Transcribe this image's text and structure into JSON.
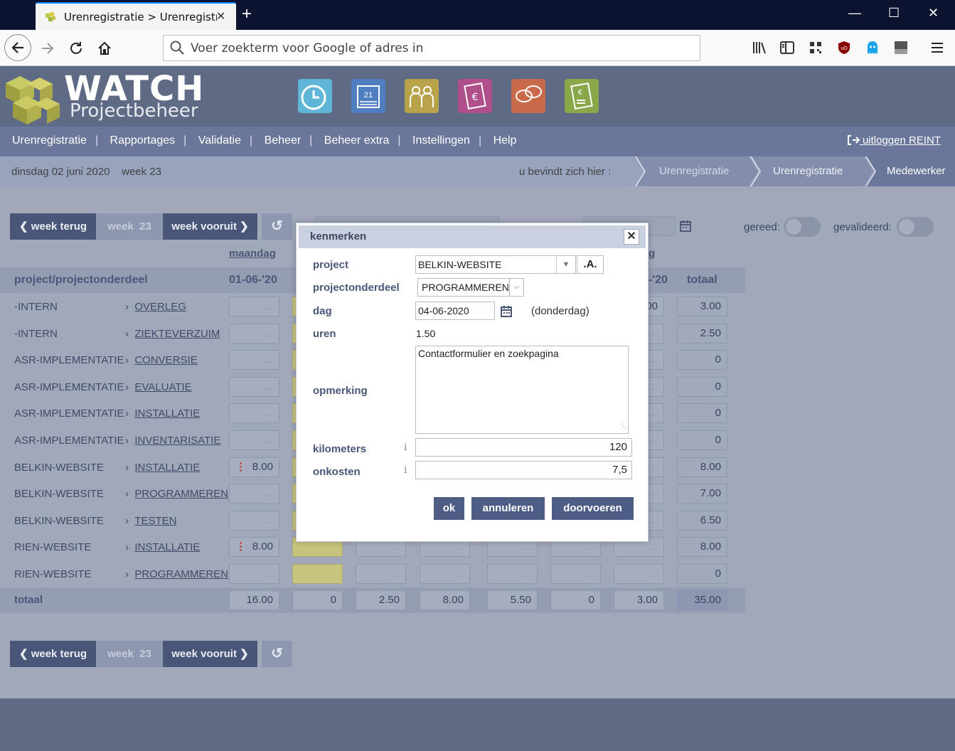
{
  "browser": {
    "tab_title": "Urenregistratie > Urenregistratie",
    "tab_close": "✕",
    "new_tab": "+",
    "window_controls": [
      "—",
      "☐",
      "✕"
    ],
    "url_placeholder": "Voer zoekterm voor Google of adres in",
    "toolbar_icons": [
      "library-icon",
      "sidebar-icon",
      "qr-icon",
      "ublock-icon",
      "ghostery-icon",
      "extension-icon",
      "menu-icon"
    ]
  },
  "app": {
    "logo_title": "WATCH",
    "logo_subtitle": "Projectbeheer",
    "app_icons": [
      {
        "name": "clock-icon",
        "color": "#5fb6d6"
      },
      {
        "name": "calendar-icon",
        "color": "#4f7fc0"
      },
      {
        "name": "people-icon",
        "color": "#b8a34a"
      },
      {
        "name": "invoice-icon",
        "color": "#b0508a"
      },
      {
        "name": "chat-icon",
        "color": "#c86a4a"
      },
      {
        "name": "calculator-icon",
        "color": "#8aa84a"
      }
    ],
    "menu": [
      "Urenregistratie",
      "Rapportages",
      "Validatie",
      "Beheer",
      "Beheer extra",
      "Instellingen",
      "Help"
    ],
    "logout": "uitloggen REINT",
    "date": "dinsdag 02 juni 2020",
    "week": "week 23",
    "here_label": "u bevindt zich hier :",
    "breadcrumbs": [
      "Urenregistratie",
      "Urenregistratie",
      "Medewerker"
    ]
  },
  "week_nav": {
    "back": "week terug",
    "current_label": "week",
    "current_number": "23",
    "forward": "week vooruit",
    "ready_label": "gereed:",
    "validated_label": "gevalideerd:"
  },
  "grid": {
    "day_header": "maandag",
    "day_header_partial": "g",
    "col_project": "project/projectonderdeel",
    "col_date1": "01-06-'20",
    "col_date_last": "-'20",
    "col_total": "totaal",
    "rows": [
      {
        "project": "-INTERN",
        "part": "OVERLEG",
        "mon": "...",
        "partial": "00",
        "total": "3.00"
      },
      {
        "project": "-INTERN",
        "part": "ZIEKTEVERZUIM",
        "mon": "...",
        "partial": "...",
        "total": "2.50"
      },
      {
        "project": "ASR-IMPLEMENTATIE",
        "part": "CONVERSIE",
        "mon": "...",
        "partial": "...",
        "total": "0"
      },
      {
        "project": "ASR-IMPLEMENTATIE",
        "part": "EVALUATIE",
        "mon": "...",
        "partial": "...",
        "total": "0"
      },
      {
        "project": "ASR-IMPLEMENTATIE",
        "part": "INSTALLATIE",
        "mon": "...",
        "partial": "...",
        "total": "0"
      },
      {
        "project": "ASR-IMPLEMENTATIE",
        "part": "INVENTARISATIE",
        "mon": "...",
        "partial": "...",
        "total": "0"
      },
      {
        "project": "BELKIN-WEBSITE",
        "part": "INSTALLATIE",
        "mon": "8.00",
        "partial": "...",
        "total": "8.00"
      },
      {
        "project": "BELKIN-WEBSITE",
        "part": "PROGRAMMEREN",
        "mon": "...",
        "partial": "...",
        "total": "7.00"
      },
      {
        "project": "BELKIN-WEBSITE",
        "part": "TESTEN",
        "mon": "...",
        "partial": "...",
        "total": "6.50"
      },
      {
        "project": "RIEN-WEBSITE",
        "part": "INSTALLATIE",
        "mon": "8.00",
        "partial": "...",
        "total": "8.00"
      },
      {
        "project": "RIEN-WEBSITE",
        "part": "PROGRAMMEREN",
        "mon": "...",
        "partial": "...",
        "total": "0"
      }
    ],
    "row_dots": [
      "...",
      "...",
      "...",
      "...",
      "...",
      "..."
    ],
    "totals_label": "totaal",
    "totals": [
      "16.00",
      "0",
      "2.50",
      "8.00",
      "5.50",
      "0",
      "3.00",
      "35.00"
    ]
  },
  "dialog": {
    "title": "kenmerken",
    "close": "✕",
    "project_label": "project",
    "project_value": "BELKIN-WEBSITE",
    "project_btn": ".A.",
    "part_label": "projectonderdeel",
    "part_value": "PROGRAMMEREN",
    "day_label": "dag",
    "day_value": "04-06-2020",
    "day_name": "(donderdag)",
    "hours_label": "uren",
    "hours_value": "1.50",
    "remark_label": "opmerking",
    "remark_value": "Contactformulier en zoekpagina",
    "km_label": "kilometers",
    "km_value": "120",
    "cost_label": "onkosten",
    "cost_value": "7,5",
    "info_glyph": "i",
    "ok": "ok",
    "cancel": "annuleren",
    "apply": "doorvoeren"
  }
}
